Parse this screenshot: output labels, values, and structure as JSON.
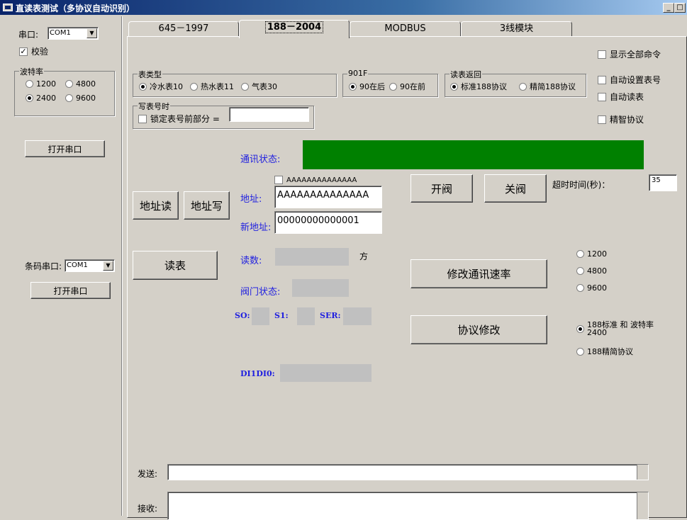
{
  "window": {
    "title": "直读表测试（多协议自动识别）"
  },
  "left": {
    "port_label": "串口:",
    "port_value": "COM1",
    "verify_label": "校验",
    "baud_group": "波特率",
    "bauds": [
      "1200",
      "4800",
      "2400",
      "9600"
    ],
    "open_port": "打开串口",
    "barcode_label": "条码串口:",
    "barcode_value": "COM1",
    "open_barcode": "打开串口"
  },
  "tabs": [
    "645－1997",
    "188－2004",
    "MODBUS",
    "3线模块"
  ],
  "panel": {
    "show_all": "显示全部命令",
    "auto_set_meter": "自动设置表号",
    "auto_read": "自动读表",
    "smart_protocol": "精智协议",
    "meter_type": {
      "title": "表类型",
      "opts": [
        "冷水表10",
        "热水表11",
        "气表30"
      ]
    },
    "f901": {
      "title": "901F",
      "opts": [
        "90在后",
        "90在前"
      ]
    },
    "read_return": {
      "title": "读表返回",
      "opts": [
        "标准188协议",
        "精简188协议"
      ]
    },
    "write_meter": {
      "title": "写表号时",
      "lock_label": "锁定表号前部分 ="
    },
    "comm_status_label": "通讯状态:",
    "comm_status_color": "#008000",
    "addr_check": "AAAAAAAAAAAAAA",
    "addr_label": "地址:",
    "addr_value": "AAAAAAAAAAAAAA",
    "new_addr_label": "新地址:",
    "new_addr_value": "00000000000001",
    "addr_read": "地址读",
    "addr_write": "地址写",
    "open_valve": "开阀",
    "close_valve": "关阀",
    "timeout_label": "超时时间(秒)：",
    "timeout_value": "35",
    "read_meter": "读表",
    "reading_label": "读数:",
    "reading_unit": "方",
    "valve_status_label": "阀门状态:",
    "modify_rate": "修改通讯速率",
    "rates": [
      "1200",
      "4800",
      "9600"
    ],
    "s0": "SO:",
    "s1": "S1:",
    "ser": "SER:",
    "modify_protocol": "协议修改",
    "proto_opts": [
      "188标准 和 波特率2400",
      "188精简协议"
    ],
    "di_label": "DI1DI0:",
    "send_label": "发送:",
    "recv_label": "接收:"
  }
}
